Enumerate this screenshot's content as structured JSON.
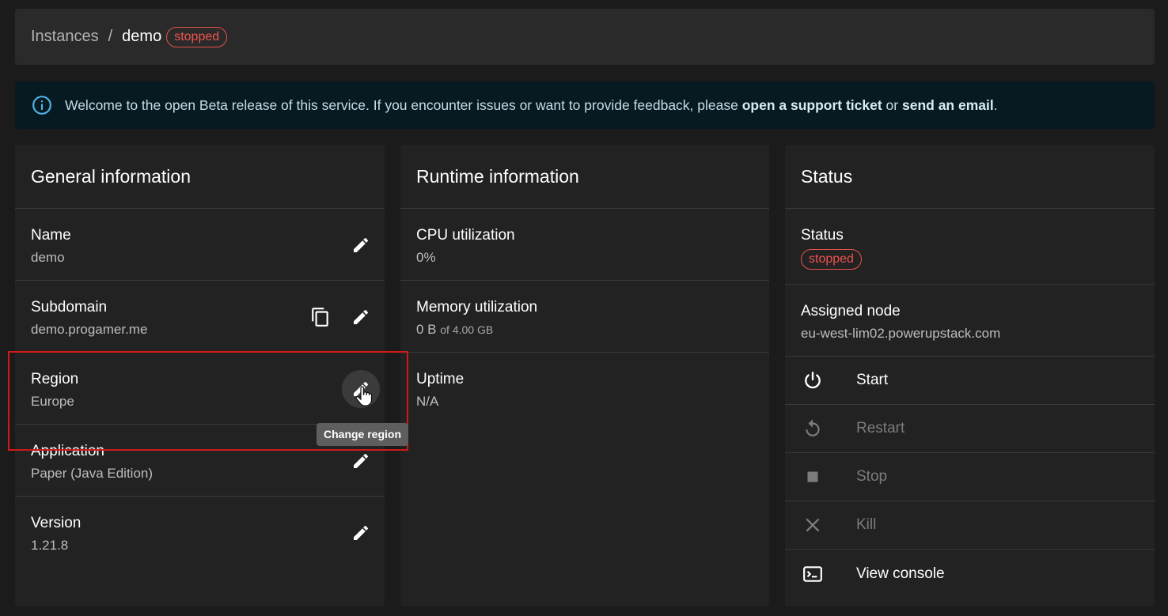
{
  "breadcrumb": {
    "root": "Instances",
    "separator": "/",
    "current": "demo",
    "status_chip": "stopped"
  },
  "banner": {
    "icon": "info-icon",
    "text_before": "Welcome to the open Beta release of this service. If you encounter issues or want to provide feedback, please ",
    "link_ticket": "open a support ticket",
    "text_middle": " or ",
    "link_email": "send an email",
    "text_after": "."
  },
  "general": {
    "title": "General information",
    "rows": [
      {
        "label": "Name",
        "value": "demo"
      },
      {
        "label": "Subdomain",
        "value": "demo.progamer.me"
      },
      {
        "label": "Region",
        "value": "Europe"
      },
      {
        "label": "Application",
        "value": "Paper (Java Edition)"
      },
      {
        "label": "Version",
        "value": "1.21.8"
      }
    ],
    "tooltip": "Change region"
  },
  "runtime": {
    "title": "Runtime information",
    "rows": [
      {
        "label": "CPU utilization",
        "value": "0%"
      },
      {
        "label": "Memory utilization",
        "value": "0 B",
        "value_suffix": "of 4.00 GB"
      },
      {
        "label": "Uptime",
        "value": "N/A"
      }
    ]
  },
  "status": {
    "title": "Status",
    "status_label": "Status",
    "status_chip": "stopped",
    "node_label": "Assigned node",
    "node_value": "eu-west-lim02.powerupstack.com",
    "actions": [
      {
        "label": "Start",
        "icon": "power-icon",
        "enabled": true
      },
      {
        "label": "Restart",
        "icon": "restart-icon",
        "enabled": false
      },
      {
        "label": "Stop",
        "icon": "stop-icon",
        "enabled": false
      },
      {
        "label": "Kill",
        "icon": "close-icon",
        "enabled": false
      },
      {
        "label": "View console",
        "icon": "terminal-icon",
        "enabled": true
      }
    ]
  },
  "colors": {
    "background": "#1b1b1b",
    "card": "#222222",
    "status_stopped": "#ef5350",
    "highlight_box": "#d01919",
    "banner_bg": "#071a21"
  }
}
